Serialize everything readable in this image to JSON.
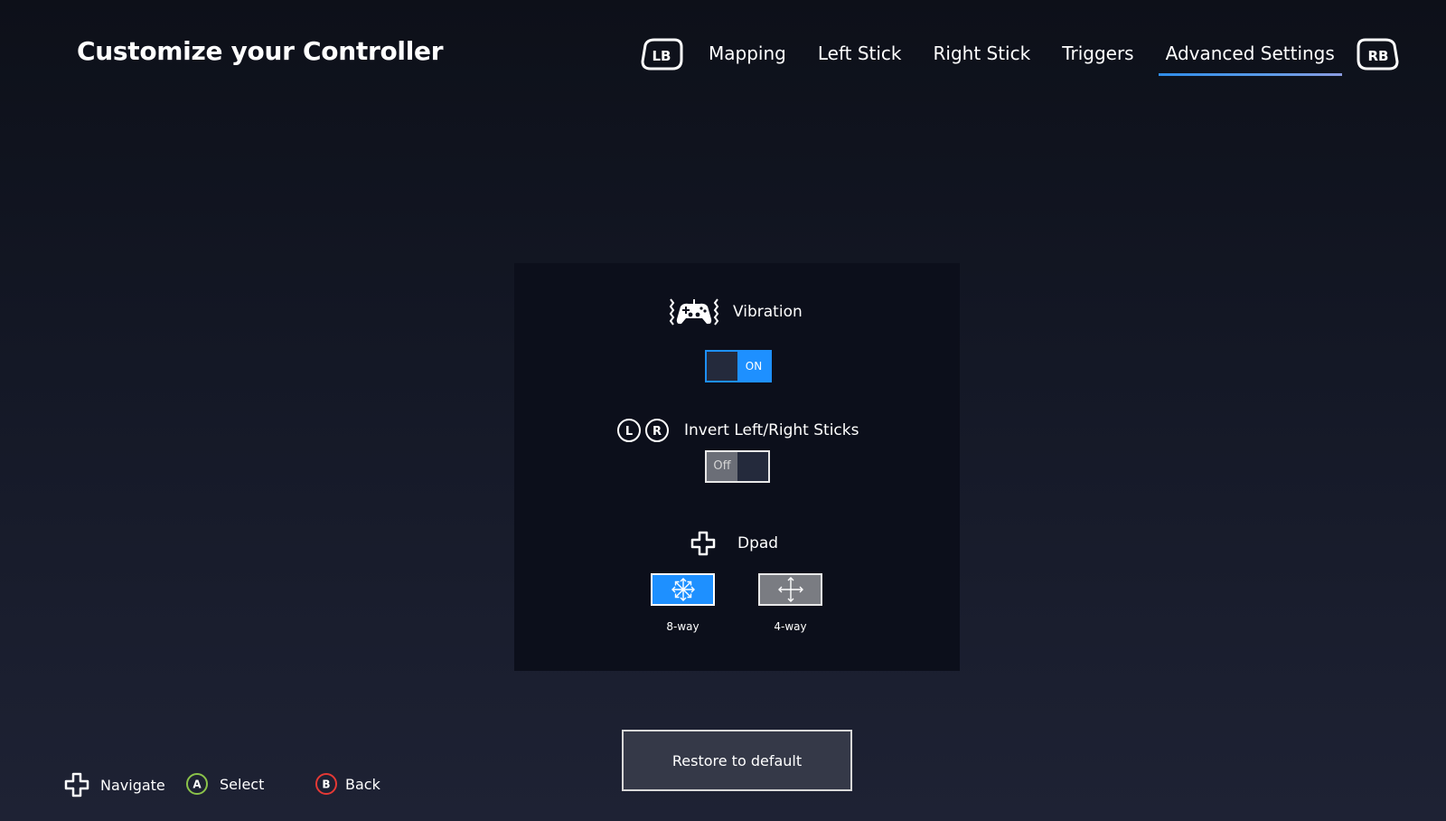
{
  "header": {
    "title": "Customize your Controller",
    "left_bumper": "LB",
    "right_bumper": "RB",
    "tabs": [
      {
        "label": "Mapping",
        "active": false
      },
      {
        "label": "Left Stick",
        "active": false
      },
      {
        "label": "Right Stick",
        "active": false
      },
      {
        "label": "Triggers",
        "active": false
      },
      {
        "label": "Advanced Settings",
        "active": true
      }
    ]
  },
  "settings": {
    "vibration": {
      "label": "Vibration",
      "icon": "vibrating-controller-icon",
      "state": "ON"
    },
    "invert_sticks": {
      "label": "Invert Left/Right Sticks",
      "icon_left": "L",
      "icon_right": "R",
      "state": "Off"
    },
    "dpad": {
      "label": "Dpad",
      "icon": "dpad-icon",
      "options": [
        {
          "label": "8-way",
          "icon": "eight-way-arrows-icon",
          "selected": true
        },
        {
          "label": "4-way",
          "icon": "four-way-arrows-icon",
          "selected": false
        }
      ]
    }
  },
  "restore_button": "Restore to default",
  "footer": {
    "navigate": {
      "glyph": "dpad-icon",
      "label": "Navigate"
    },
    "select": {
      "glyph": "A",
      "label": "Select"
    },
    "back": {
      "glyph": "B",
      "label": "Back"
    }
  },
  "colors": {
    "accent": "#1e90ff",
    "panel": "#0c0f1b",
    "a_button": "#8bc34a",
    "b_button": "#e53935"
  }
}
